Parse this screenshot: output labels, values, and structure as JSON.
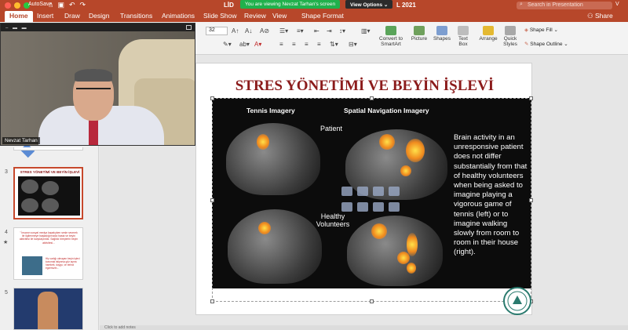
{
  "titlebar": {
    "autosave": "AutoSave",
    "doc_title": "LİD",
    "year": "L 2021",
    "share_banner": "You are viewing Nevzat Tarhan's screen",
    "view_options": "View Options ⌄",
    "search_placeholder": "Search in Presentation",
    "window_right": "V"
  },
  "tabs": [
    "Home",
    "Insert",
    "Draw",
    "Design",
    "Transitions",
    "Animations",
    "Slide Show",
    "Review",
    "View",
    "Shape Format"
  ],
  "share_label": "Share",
  "ribbon": {
    "font_size": "32",
    "convert_line1": "Convert to",
    "convert_line2": "SmartArt",
    "picture": "Picture",
    "shapes": "Shapes",
    "textbox_line1": "Text",
    "textbox_line2": "Box",
    "arrange": "Arrange",
    "quick_line1": "Quick",
    "quick_line2": "Styles",
    "shape_fill": "Shape Fill ⌄",
    "shape_outline": "Shape Outline ⌄"
  },
  "video": {
    "name": "Nevzat Tarhan"
  },
  "thumbs": {
    "n3": "3",
    "n4": "4",
    "n5": "5",
    "t3_title": "STRES YÖNETİMİ VE BEYİN İŞLEVİ",
    "t4_text": "\" İnsanın sosyal medya kapalıyken sesle sevmek ile ilgilenmeye başladığımızda hasta ve beyin aktivitesi ile karşılaştırdık. Sağlıklı bireylerin beyin aktivitesi...",
    "t4_text2": "Hiç varlığı olmayan beyin işlevi korumak istiyorsa göz açma hareketi, duygu, ve birinci egzersizin..."
  },
  "slide": {
    "title": "STRES YÖNETİMİ VE BEYİN İŞLEVİ",
    "heading_left": "Tennis Imagery",
    "heading_right": "Spatial Navigation Imagery",
    "label_patient": "Patient",
    "label_healthy_1": "Healthy",
    "label_healthy_2": "Volunteers",
    "description": "Brain activity in an unresponsive patient does not differ substantially from that of healthy volunteers when being asked to imagine playing a vigorous game of tennis (left) or to imagine walking slowly from room to room in their house (right).",
    "logo_text": "ÜSKÜDAR ÜNİVERSİTESİ"
  },
  "notes": "Click to add notes"
}
